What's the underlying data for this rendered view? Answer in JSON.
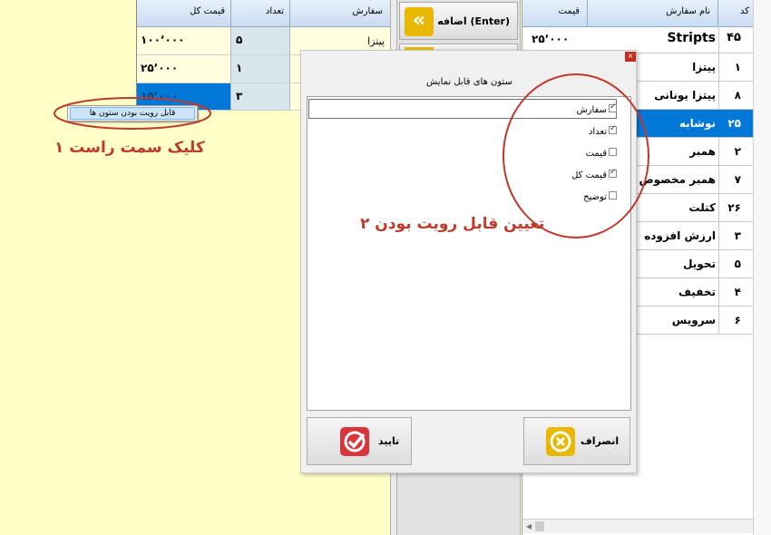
{
  "order_grid": {
    "headers": {
      "order": "سفارش",
      "qty": "تعداد",
      "total": "قیمت کل"
    },
    "rows": [
      {
        "order": "پیتزا",
        "qty": "۵",
        "total": "۱۰۰٬۰۰۰"
      },
      {
        "order": "",
        "qty": "۱",
        "total": "۲۵٬۰۰۰"
      },
      {
        "order": "",
        "qty": "۳",
        "total": "۱۵٬۰۰۰"
      }
    ]
  },
  "context_menu": {
    "item": "قابل رویت بودن ستون ها"
  },
  "add_button": {
    "label": "اضافه (Enter)"
  },
  "menu_grid": {
    "headers": {
      "code": "کد",
      "name": "نام سفارش",
      "price": "قیمت"
    },
    "rows": [
      {
        "code": "۴۵",
        "name": "Stripts",
        "price": "۲۵٬۰۰۰"
      },
      {
        "code": "۱",
        "name": "پیتزا",
        "price": ""
      },
      {
        "code": "۸",
        "name": "پیتزا یونانی",
        "price": ""
      },
      {
        "code": "۲۵",
        "name": "نوشابه",
        "price": ""
      },
      {
        "code": "۲",
        "name": "همبر",
        "price": ""
      },
      {
        "code": "۷",
        "name": "همبر مخصوص",
        "price": ""
      },
      {
        "code": "۲۶",
        "name": "کتلت",
        "price": ""
      },
      {
        "code": "۳",
        "name": "ارزش افزوده",
        "price": ""
      },
      {
        "code": "۵",
        "name": "تحویل",
        "price": ""
      },
      {
        "code": "۴",
        "name": "تخفیف",
        "price": ""
      },
      {
        "code": "۶",
        "name": "سرویس",
        "price": ""
      }
    ]
  },
  "dialog": {
    "title": "ستون های قابل نمایش",
    "columns": [
      {
        "label": "سفارش",
        "checked": true
      },
      {
        "label": "تعداد",
        "checked": true
      },
      {
        "label": "قیمت",
        "checked": false
      },
      {
        "label": "قیمت کل",
        "checked": true
      },
      {
        "label": "توضیح",
        "checked": false
      }
    ],
    "ok_label": "تایید",
    "cancel_label": "انصراف"
  },
  "annotations": {
    "step1": "۱ کلیک سمت راست",
    "step2": "۲ تعیین قابل رویت بودن"
  },
  "colors": {
    "accent_red": "#c0392b",
    "selection_blue": "#0078d7",
    "qty_cell": "#d6e6ec",
    "background": "#ffffc8"
  }
}
